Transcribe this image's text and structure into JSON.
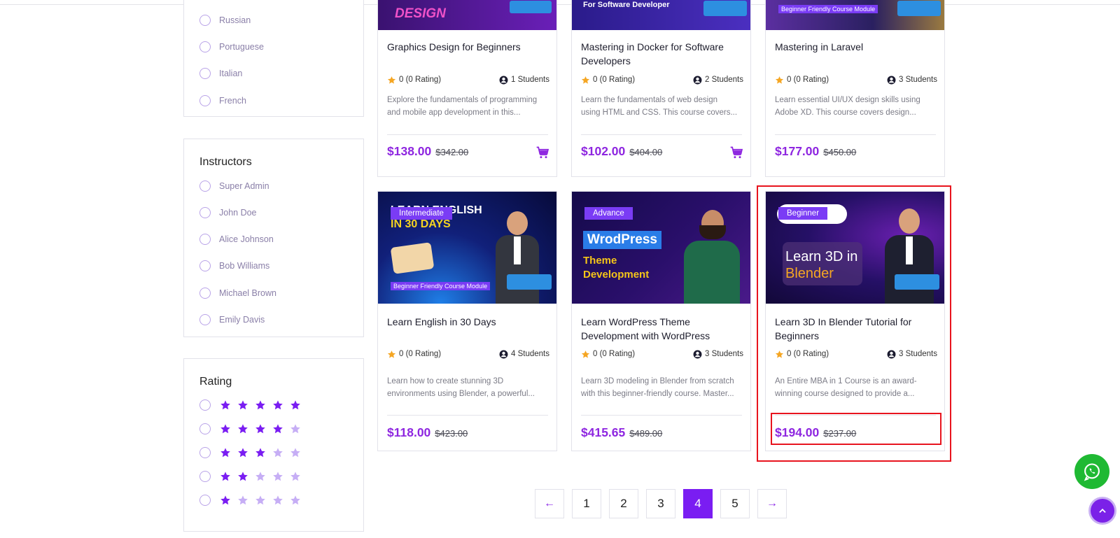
{
  "filters": {
    "languages": [
      "Russian",
      "Portuguese",
      "Italian",
      "French"
    ],
    "instructors": {
      "title": "Instructors",
      "items": [
        "Super Admin",
        "John Doe",
        "Alice Johnson",
        "Bob Williams",
        "Michael Brown",
        "Emily Davis"
      ]
    },
    "rating": {
      "title": "Rating",
      "options": [
        5,
        4,
        3,
        2,
        1
      ],
      "max": 5
    }
  },
  "courses": [
    {
      "title": "Graphics Design for Beginners",
      "rating": "0 (0 Rating)",
      "students": "1 Students",
      "description_lines": [
        "Explore the fundamentals of programming",
        "and mobile app development in this..."
      ],
      "price": "$138.00",
      "old_price": "$342.00",
      "has_cart": true,
      "thumb_text": "DESIGN"
    },
    {
      "title": "Mastering in Docker for Software Developers",
      "rating": "0 (0 Rating)",
      "students": "2 Students",
      "description_lines": [
        "Learn the fundamentals of web design",
        "using HTML and CSS. This course covers..."
      ],
      "price": "$102.00",
      "old_price": "$404.00",
      "has_cart": true,
      "thumb_text": "For Software Developer"
    },
    {
      "title": "Mastering in Laravel",
      "rating": "0 (0 Rating)",
      "students": "3 Students",
      "description_lines": [
        "Learn essential UI/UX design skills using",
        "Adobe XD. This course covers design..."
      ],
      "price": "$177.00",
      "old_price": "$450.00",
      "has_cart": false,
      "thumb_text": "Beginner Friendly Course Module"
    },
    {
      "title": "Learn English in 30 Days",
      "level": "Intermediate",
      "rating": "0 (0 Rating)",
      "students": "4 Students",
      "description_lines": [
        "Learn how to create stunning 3D",
        "environments using Blender, a powerful..."
      ],
      "price": "$118.00",
      "old_price": "$423.00",
      "has_cart": false,
      "thumb_text": [
        "LEARN ENGLISH",
        "IN 30 DAYS",
        "Beginner Friendly Course Module"
      ]
    },
    {
      "title": "Learn WordPress Theme Development with WordPress",
      "level": "Advance",
      "rating": "0 (0 Rating)",
      "students": "3 Students",
      "description_lines": [
        "Learn 3D modeling in Blender from scratch",
        "with this beginner-friendly course. Master..."
      ],
      "price": "$415.65",
      "old_price": "$489.00",
      "has_cart": false,
      "thumb_text": [
        "WrodPress",
        "Theme",
        "Development"
      ]
    },
    {
      "title": "Learn 3D In Blender Tutorial for Beginners",
      "level": "Beginner",
      "rating": "0 (0 Rating)",
      "students": "3 Students",
      "description_lines": [
        "An Entire MBA in 1 Course is an award-",
        "winning course designed to provide a..."
      ],
      "price": "$194.00",
      "old_price": "$237.00",
      "has_cart": false,
      "thumb_text": [
        "Learn 3D in",
        "Blender"
      ]
    }
  ],
  "pagination": {
    "prev": "←",
    "pages": [
      "1",
      "2",
      "3",
      "4",
      "5"
    ],
    "current": "4",
    "next": "→"
  },
  "colors": {
    "accent": "#7a1df2",
    "price": "#8e26e0",
    "highlight": "#e8141e",
    "whatsapp": "#1fb933",
    "star_filled": "#7a1df2",
    "star_empty": "#c6aef5",
    "rating_star": "#f5a623"
  },
  "icons": {
    "whatsapp": "whatsapp-icon",
    "scroll_top": "chevron-up-icon",
    "cart": "cart-icon",
    "students": "user-icon",
    "rating": "star-icon"
  }
}
